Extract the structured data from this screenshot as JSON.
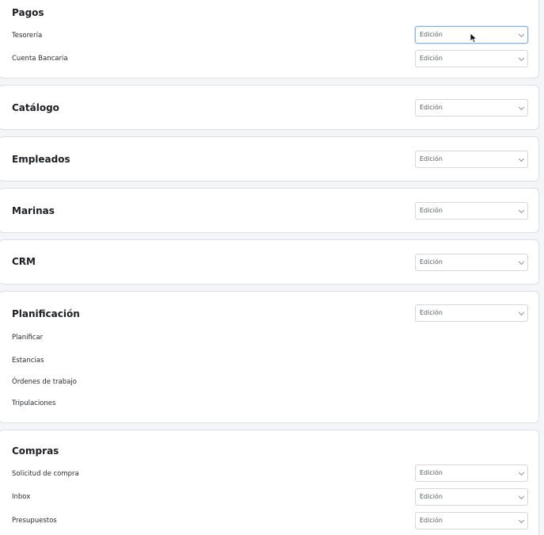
{
  "select_value": "Edición",
  "sections": {
    "pagos": {
      "title": "Pagos",
      "rows": [
        "Tesorería",
        "Cuenta Bancaria"
      ]
    },
    "catalogo": {
      "title": "Catálogo"
    },
    "empleados": {
      "title": "Empleados"
    },
    "marinas": {
      "title": "Marinas"
    },
    "crm": {
      "title": "CRM"
    },
    "planificacion": {
      "title": "Planificación",
      "rows": [
        "Planificar",
        "Estancias",
        "Órdenes de trabajo",
        "Tripulaciones"
      ]
    },
    "compras": {
      "title": "Compras",
      "rows": [
        "Solicitud de compra",
        "Inbox",
        "Presupuestos"
      ]
    }
  },
  "colors": {
    "card_border": "#dcdfe4",
    "focus_border": "#86b2d9",
    "background": "#f4f5f7"
  },
  "icons": {
    "dropdown": "chevron-down-icon",
    "cursor": "mouse-pointer-icon"
  }
}
